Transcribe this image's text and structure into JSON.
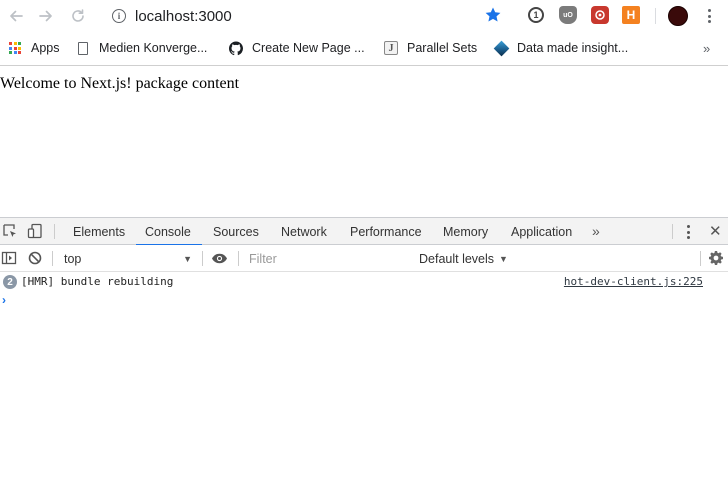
{
  "browser": {
    "url": "localhost:3000",
    "nav_icons": [
      "back-arrow-icon",
      "forward-arrow-icon",
      "reload-icon"
    ],
    "extensions": [
      "star-icon",
      "onepassword-icon",
      "ublock-icon",
      "red-extension-icon",
      "h-extension-icon"
    ],
    "h_extension_label": "H",
    "onepassword_label": "1",
    "ublock_label": "uO"
  },
  "bookmarks": {
    "items": [
      {
        "label": "Apps",
        "icon": "apps-grid-icon"
      },
      {
        "label": "Medien Konverge...",
        "icon": "document-icon"
      },
      {
        "label": "Create New Page ...",
        "icon": "github-icon"
      },
      {
        "label": "Parallel Sets",
        "icon": "j-icon",
        "icon_letter": "J"
      },
      {
        "label": "Data made insight...",
        "icon": "cube-icon"
      }
    ],
    "more": "»",
    "apps_colors": [
      "#ea4335",
      "#fbbc05",
      "#34a853",
      "#4285f4",
      "#ea4335",
      "#fbbc05",
      "#34a853",
      "#4285f4",
      "#ea4335"
    ]
  },
  "page": {
    "body_text": "Welcome to Next.js! package content"
  },
  "devtools": {
    "tabs": [
      "Elements",
      "Console",
      "Sources",
      "Network",
      "Performance",
      "Memory",
      "Application"
    ],
    "active_tab": "Console",
    "more_tabs": "»",
    "close": "✕",
    "console": {
      "context": "top",
      "filter_placeholder": "Filter",
      "levels": "Default levels",
      "messages": [
        {
          "count": "2",
          "text": "[HMR] bundle rebuilding",
          "source": "hot-dev-client.js:225"
        }
      ],
      "prompt": "›"
    },
    "accent": "#1a73e8"
  }
}
